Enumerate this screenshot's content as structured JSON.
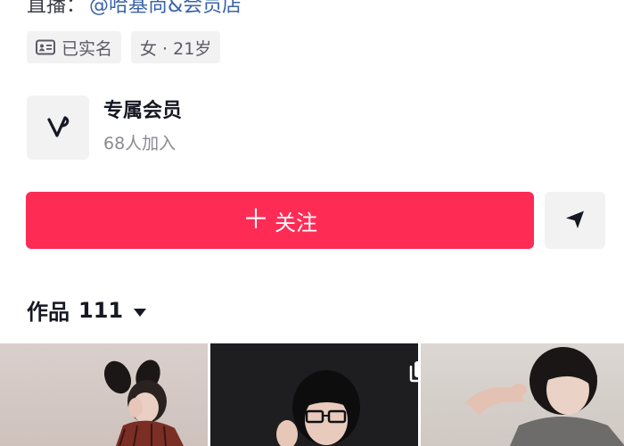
{
  "profile": {
    "live_label": "直播：",
    "live_link": "@哈基尚&会员店",
    "tags": [
      {
        "label": "已实名",
        "icon": "id-card-icon"
      },
      {
        "label": "女 · 21岁"
      }
    ]
  },
  "membership": {
    "title": "专属会员",
    "subtitle": "68人加入",
    "logo_icon": "v-logo-icon"
  },
  "actions": {
    "follow_label": "关注",
    "follow_icon": "plus-icon",
    "share_icon": "send-icon",
    "accent_color": "#fe2c55"
  },
  "works": {
    "label": "作品",
    "count": "111",
    "caret_icon": "caret-down-icon"
  },
  "thumbnails": [
    {
      "name": "work-1"
    },
    {
      "name": "work-2",
      "badge_icon": "multi-image-icon"
    },
    {
      "name": "work-3"
    }
  ]
}
